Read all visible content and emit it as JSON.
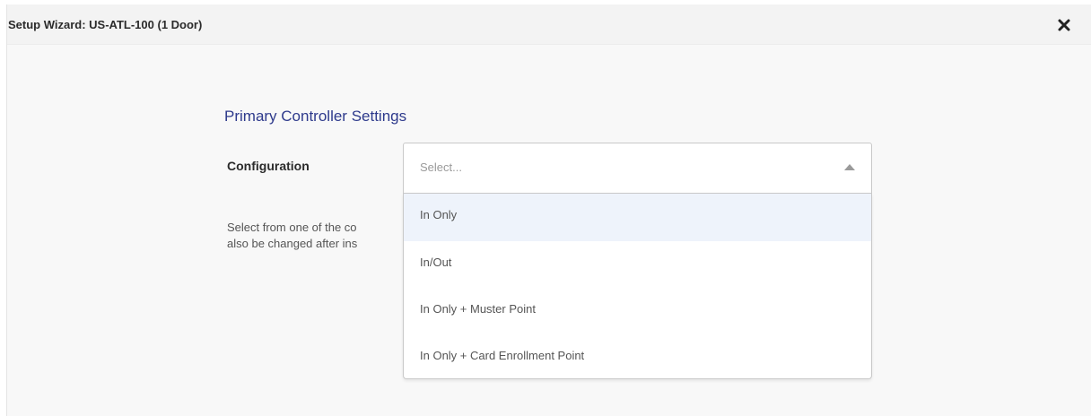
{
  "dialog": {
    "title": "Setup Wizard: US-ATL-100 (1 Door)",
    "close_icon": "close-icon"
  },
  "section": {
    "title": "Primary Controller Settings"
  },
  "configuration": {
    "label": "Configuration",
    "placeholder": "Select...",
    "help_text_line1": "Select from one of the co",
    "help_text_line2": "also be changed after ins",
    "options": [
      "In Only",
      "In/Out",
      "In Only + Muster Point",
      "In Only + Card Enrollment Point"
    ],
    "highlighted_option": "In Only"
  },
  "colors": {
    "heading": "#2e3a8c",
    "highlight": "#eef3fb"
  }
}
